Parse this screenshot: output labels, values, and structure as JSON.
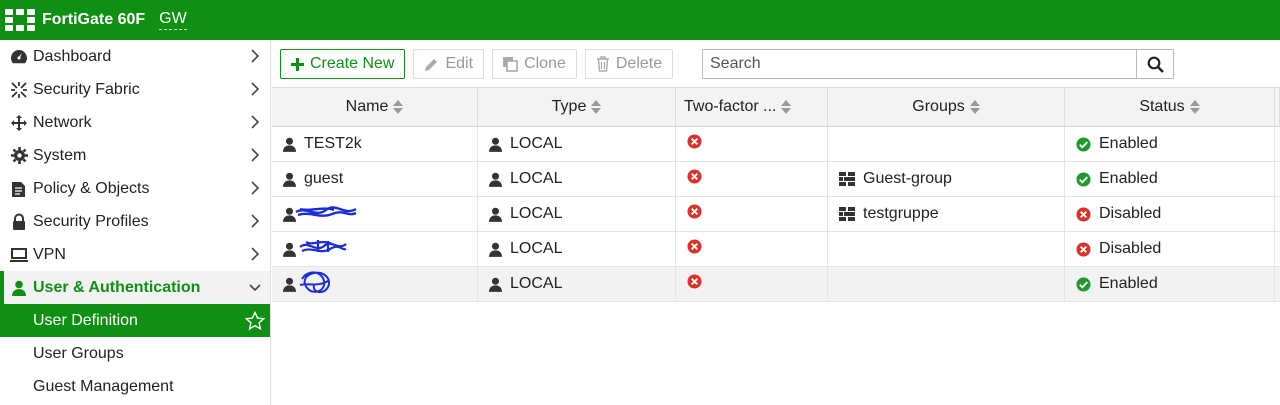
{
  "header": {
    "product": "FortiGate 60F",
    "hostname": "GW",
    "bg_color": "#0f9013"
  },
  "sidebar": {
    "items": [
      {
        "label": "Dashboard",
        "icon": "dashboard-icon"
      },
      {
        "label": "Security Fabric",
        "icon": "fabric-icon"
      },
      {
        "label": "Network",
        "icon": "network-icon"
      },
      {
        "label": "System",
        "icon": "gear-icon"
      },
      {
        "label": "Policy & Objects",
        "icon": "policy-icon"
      },
      {
        "label": "Security Profiles",
        "icon": "lock-icon"
      },
      {
        "label": "VPN",
        "icon": "vpn-icon"
      },
      {
        "label": "User & Authentication",
        "icon": "user-icon"
      }
    ],
    "sub_items": [
      {
        "label": "User Definition"
      },
      {
        "label": "User Groups"
      },
      {
        "label": "Guest Management"
      }
    ]
  },
  "toolbar": {
    "create_new": "Create New",
    "edit": "Edit",
    "clone": "Clone",
    "delete": "Delete",
    "search_placeholder": "Search"
  },
  "table": {
    "columns": [
      "Name",
      "Type",
      "Two-factor ...",
      "Groups",
      "Status"
    ],
    "rows": [
      {
        "name": "TEST2k",
        "type": "LOCAL",
        "two_factor": "disabled",
        "groups": "",
        "status": "Enabled"
      },
      {
        "name": "guest",
        "type": "LOCAL",
        "two_factor": "disabled",
        "groups": "Guest-group",
        "status": "Enabled"
      },
      {
        "name": "",
        "type": "LOCAL",
        "two_factor": "disabled",
        "groups": "testgruppe",
        "status": "Disabled"
      },
      {
        "name": "",
        "type": "LOCAL",
        "two_factor": "disabled",
        "groups": "",
        "status": "Disabled"
      },
      {
        "name": "",
        "type": "LOCAL",
        "two_factor": "disabled",
        "groups": "",
        "status": "Enabled"
      }
    ]
  },
  "colors": {
    "accent": "#0f9013",
    "enabled": "#1e9a2a",
    "disabled": "#d9332b"
  }
}
